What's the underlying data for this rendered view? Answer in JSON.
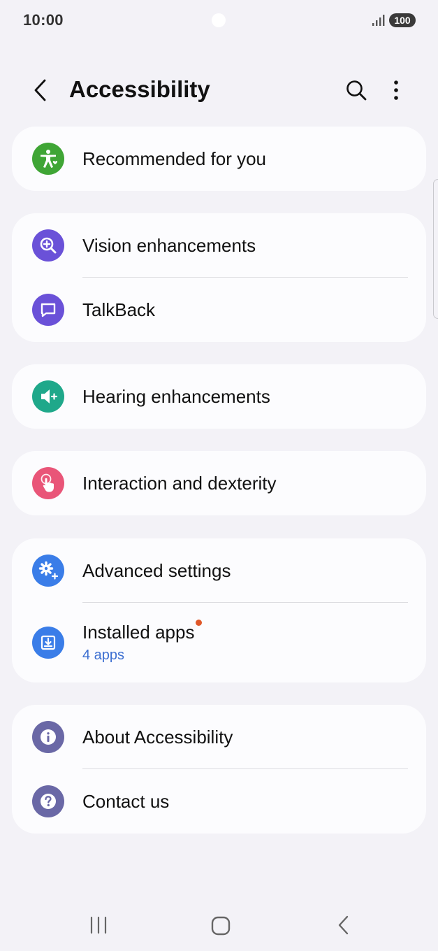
{
  "status_bar": {
    "time": "10:00",
    "battery": "100",
    "icons": [
      "signal-icon",
      "battery-icon"
    ]
  },
  "header": {
    "title": "Accessibility",
    "icons": [
      "back-arrow-icon",
      "search-icon",
      "more-vertical-icon"
    ]
  },
  "sections": {
    "recommended": {
      "label": "Recommended for you",
      "icon": "accessibility-person-icon",
      "color": "#3fa535"
    },
    "vision": {
      "label": "Vision enhancements",
      "icon": "magnify-plus-icon",
      "color": "#6a51d8"
    },
    "talkback": {
      "label": "TalkBack",
      "icon": "speech-bubble-icon",
      "color": "#6a51d8"
    },
    "hearing": {
      "label": "Hearing enhancements",
      "icon": "speaker-plus-icon",
      "color": "#1fa88a"
    },
    "interaction": {
      "label": "Interaction and dexterity",
      "icon": "touch-hand-icon",
      "color": "#e95578"
    },
    "advanced": {
      "label": "Advanced settings",
      "icon": "gears-plus-icon",
      "color": "#3a7de8"
    },
    "installed": {
      "label": "Installed apps",
      "sub": "4 apps",
      "icon": "download-box-icon",
      "color": "#3a7de8",
      "accent": "#3d6fd1",
      "new_dot_color": "#e0582a"
    },
    "about": {
      "label": "About Accessibility",
      "icon": "info-icon",
      "color": "#6a68a6"
    },
    "contact": {
      "label": "Contact us",
      "icon": "question-icon",
      "color": "#6a68a6"
    }
  },
  "nav_bar": {
    "icons": [
      "recents-icon",
      "home-icon",
      "back-icon"
    ]
  }
}
